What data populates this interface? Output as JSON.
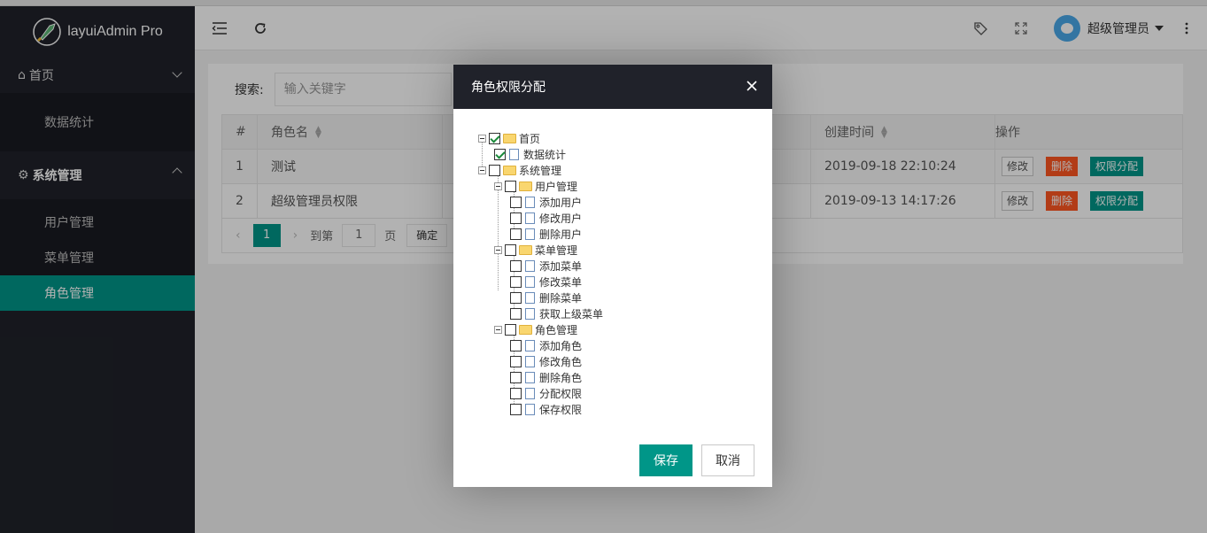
{
  "app": {
    "logo_text": "layuiAdmin Pro"
  },
  "sidebar": {
    "home": {
      "label": "首页"
    },
    "home_children": [
      {
        "label": "数据统计"
      }
    ],
    "system": {
      "label": "系统管理"
    },
    "system_children": [
      {
        "label": "用户管理"
      },
      {
        "label": "菜单管理"
      },
      {
        "label": "角色管理",
        "active": true
      }
    ]
  },
  "header": {
    "username": "超级管理员"
  },
  "search": {
    "label": "搜索:",
    "placeholder": "输入关键字"
  },
  "table": {
    "columns": [
      "#",
      "角色名",
      "创建时间",
      "操作"
    ],
    "rows": [
      {
        "no": "1",
        "name": "测试",
        "created": "2019-09-18 22:10:24"
      },
      {
        "no": "2",
        "name": "超级管理员权限",
        "created": "2019-09-13 14:17:26"
      }
    ],
    "actions": {
      "edit": "修改",
      "delete": "删除",
      "assign": "权限分配"
    }
  },
  "pager": {
    "current": "1",
    "goto_label": "到第",
    "page_input": "1",
    "page_label": "页",
    "confirm": "确定"
  },
  "dialog": {
    "title": "角色权限分配",
    "tree": {
      "home": "首页",
      "stats": "数据统计",
      "system": "系统管理",
      "user_mgmt": "用户管理",
      "add_user": "添加用户",
      "edit_user": "修改用户",
      "del_user": "删除用户",
      "menu_mgmt": "菜单管理",
      "add_menu": "添加菜单",
      "edit_menu": "修改菜单",
      "del_menu": "删除菜单",
      "get_parent_menu": "获取上级菜单",
      "role_mgmt": "角色管理",
      "add_role": "添加角色",
      "edit_role": "修改角色",
      "del_role": "删除角色",
      "assign_perm": "分配权限",
      "save_perm": "保存权限"
    },
    "save": "保存",
    "cancel": "取消"
  },
  "colors": {
    "sidebar_bg": "#20222a",
    "accent": "#009688",
    "danger": "#ff5722"
  }
}
